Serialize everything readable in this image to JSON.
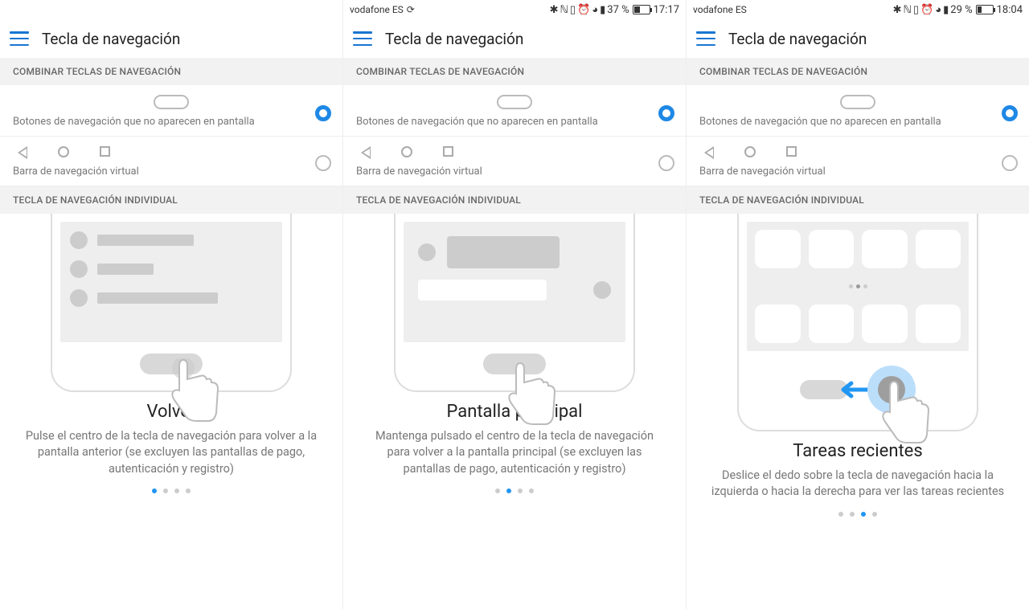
{
  "screens": [
    {
      "statusbar": {
        "carrier": "",
        "icons": "",
        "battery_pct": "",
        "time": "",
        "battery_fill": 0
      },
      "app_title": "Tecla de navegación",
      "section1": "COMBINAR TECLAS DE NAVEGACIÓN",
      "option1_label": "Botones de navegación que no aparecen en pantalla",
      "option2_label": "Barra de navegación virtual",
      "section2": "TECLA DE NAVEGACIÓN INDIVIDUAL",
      "card_title": "Volver",
      "card_desc": "Pulse el centro de la tecla de navegación para volver a la pantalla anterior (se excluyen las pantallas de pago, autenticación y registro)",
      "active_dot": 0
    },
    {
      "statusbar": {
        "carrier": "vodafone ES",
        "icons": "✱ ℕ ⏰ 📶",
        "battery_pct": "37 %",
        "time": "17:17",
        "battery_fill": 37
      },
      "app_title": "Tecla de navegación",
      "section1": "COMBINAR TECLAS DE NAVEGACIÓN",
      "option1_label": "Botones de navegación que no aparecen en pantalla",
      "option2_label": "Barra de navegación virtual",
      "section2": "TECLA DE NAVEGACIÓN INDIVIDUAL",
      "card_title": "Pantalla principal",
      "card_desc": "Mantenga pulsado el centro de la tecla de navegación para volver a la pantalla principal (se excluyen las pantallas de pago, autenticación y registro)",
      "active_dot": 1
    },
    {
      "statusbar": {
        "carrier": "vodafone ES",
        "icons": "✱ ℕ ⏰ 📶",
        "battery_pct": "29 %",
        "time": "18:04",
        "battery_fill": 29
      },
      "app_title": "Tecla de navegación",
      "section1": "COMBINAR TECLAS DE NAVEGACIÓN",
      "option1_label": "Botones de navegación que no aparecen en pantalla",
      "option2_label": "Barra de navegación virtual",
      "section2": "TECLA DE NAVEGACIÓN INDIVIDUAL",
      "card_title": "Tareas recientes",
      "card_desc": "Deslice el dedo sobre la tecla de navegación hacia la izquierda o hacia la derecha para ver las tareas recientes",
      "active_dot": 2
    }
  ]
}
